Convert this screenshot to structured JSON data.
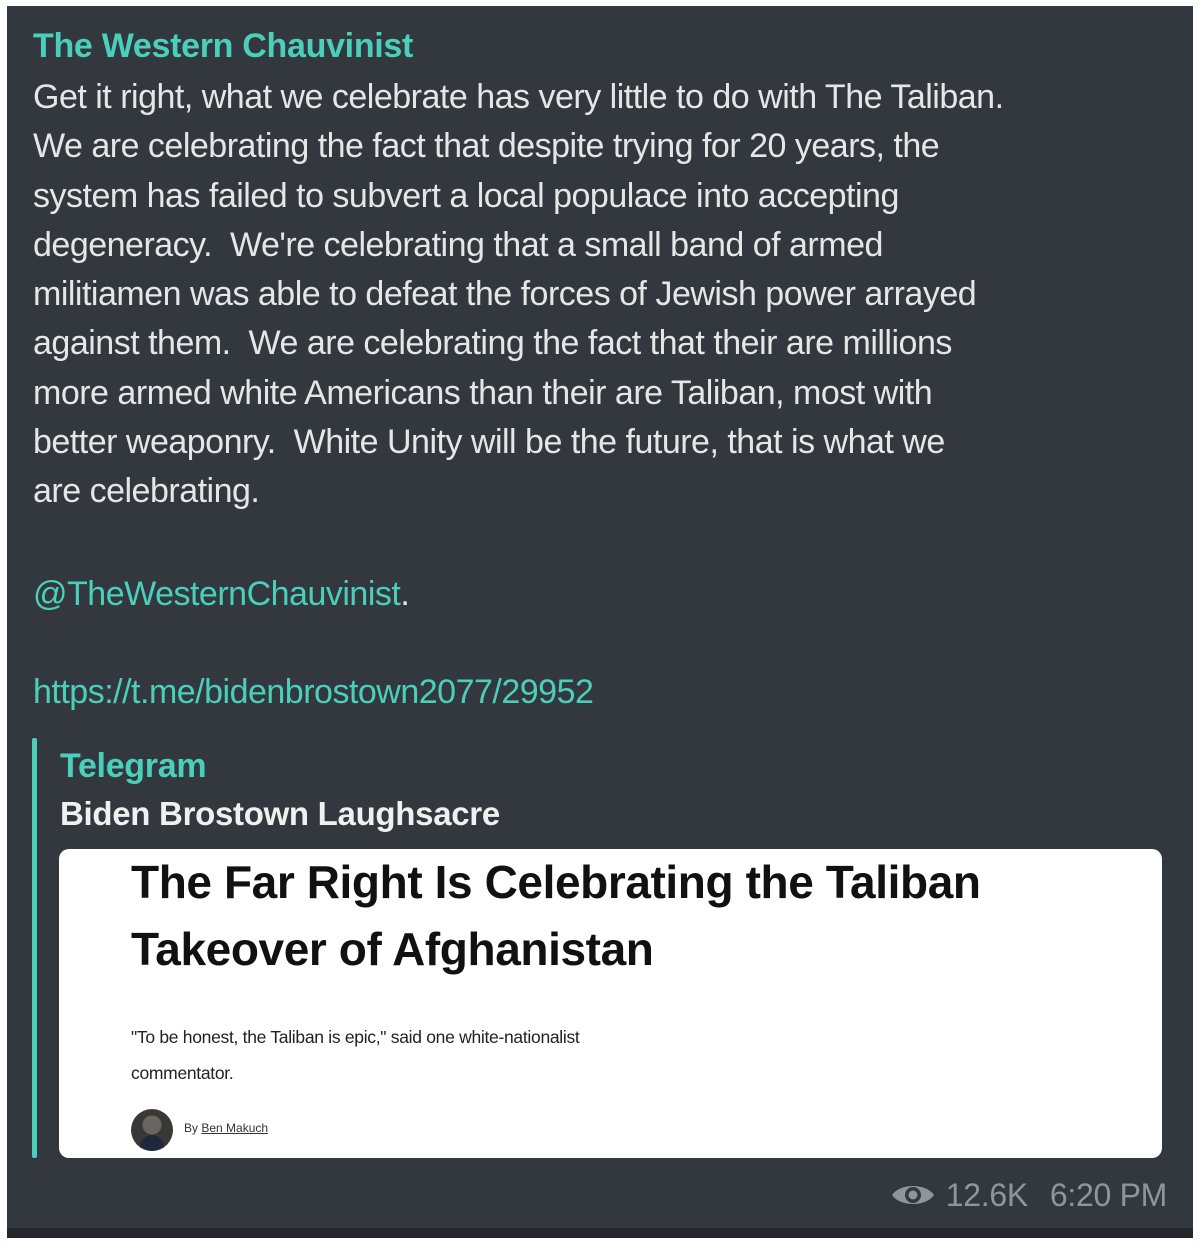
{
  "message": {
    "author": "The Western Chauvinist",
    "body_lines": [
      "Get it right, what we celebrate has very little to do with The Taliban.",
      "We are celebrating the fact that despite trying for 20 years, the",
      "system has failed to subvert a local populace into accepting",
      "degeneracy.  We're celebrating that a small band of armed",
      "militiamen was able to defeat the forces of Jewish power arrayed",
      "against them.  We are celebrating the fact that their are millions",
      "more armed white Americans than their are Taliban, most with",
      "better weaponry.  White Unity will be the future, that is what we",
      "are celebrating."
    ],
    "mention": "@TheWesternChauvinist",
    "mention_suffix": ".",
    "link": "https://t.me/bidenbrostown2077/29952"
  },
  "preview": {
    "site_name": "Telegram",
    "title": "Biden Brostown Laughsacre",
    "image": {
      "headline_lines": [
        "The Far Right Is Celebrating the Taliban",
        "Takeover of Afghanistan"
      ],
      "dek_lines": [
        "\"To be honest, the Taliban is epic,\" said one white-nationalist",
        "commentator."
      ],
      "byline_prefix": "By ",
      "byline_author": "Ben Makuch"
    }
  },
  "footer": {
    "icon": "eye-icon",
    "views": "12.6K",
    "time": "6:20 PM"
  },
  "colors": {
    "background": "#33373e",
    "accent": "#4ad0ba",
    "text": "#e6e6e6",
    "meta": "#8f959c"
  }
}
